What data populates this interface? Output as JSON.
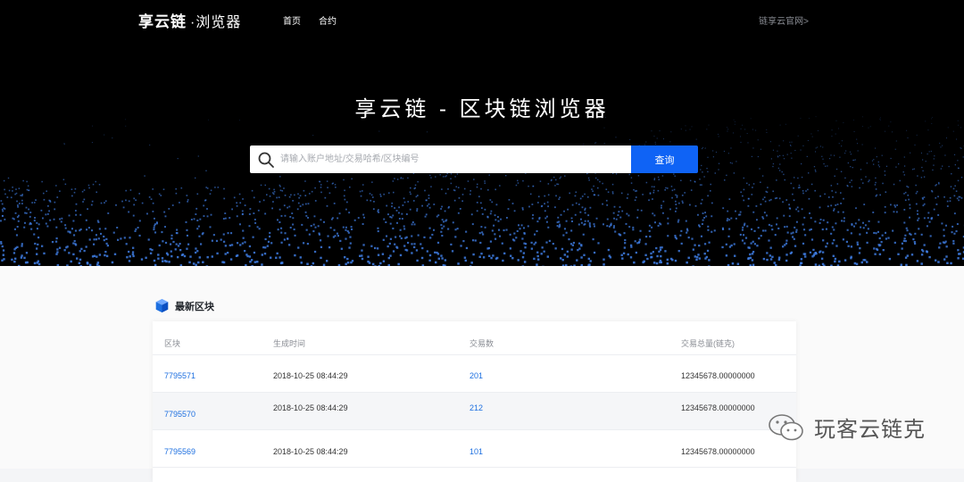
{
  "nav": {
    "logo_main": "享云链",
    "logo_sub": "·浏览器",
    "links": [
      "首页",
      "合约"
    ],
    "official_link": "链享云官网>"
  },
  "hero": {
    "title": "享云链 - 区块链浏览器",
    "search_placeholder": "请输入账户地址/交易哈希/区块编号",
    "search_button": "查询"
  },
  "section": {
    "title": "最新区块"
  },
  "table": {
    "headers": [
      "区块",
      "生成时间",
      "交易数",
      "交易总量(链克)"
    ],
    "rows": [
      {
        "block": "7795571",
        "time": "2018-10-25 08:44:29",
        "tx_count": "201",
        "tx_total": "12345678.00000000"
      },
      {
        "block": "7795570",
        "time": "2018-10-25 08:44:29",
        "tx_count": "212",
        "tx_total": "12345678.00000000"
      },
      {
        "block": "7795569",
        "time": "2018-10-25 08:44:29",
        "tx_count": "101",
        "tx_total": "12345678.00000000"
      }
    ]
  },
  "watermark": {
    "text": "玩客云链克",
    "icon": "wechat-icon"
  },
  "colors": {
    "accent": "#0f63f5",
    "link": "#1d6fe0",
    "hero_bg": "#000000",
    "particles": "#3e7be0"
  }
}
